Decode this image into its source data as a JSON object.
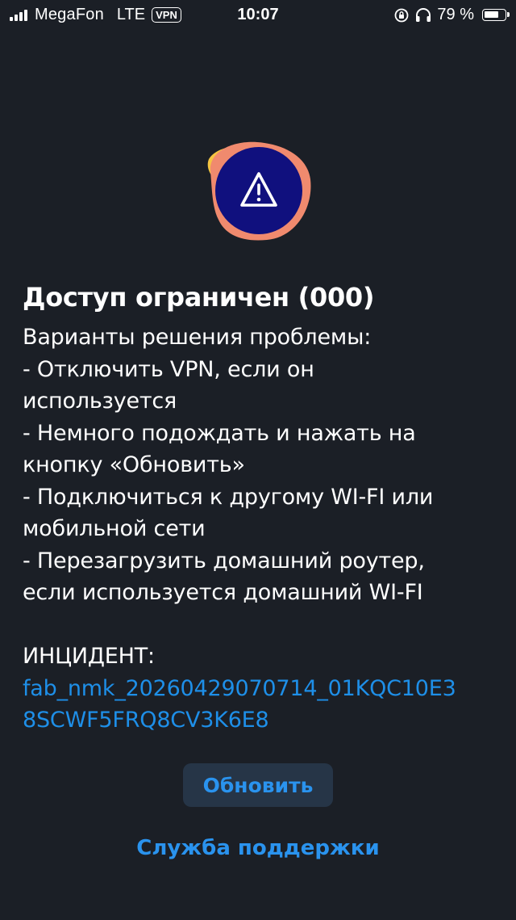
{
  "status_bar": {
    "carrier": "MegaFon",
    "network": "LTE",
    "vpn_badge": "VPN",
    "time": "10:07",
    "battery_percent_label": "79 %",
    "battery_level": 0.79,
    "icons": [
      "signal-icon",
      "orientation-lock-icon",
      "headphones-icon",
      "battery-icon"
    ]
  },
  "error": {
    "illustration_icon": "warning-icon",
    "title": "Доступ ограничен (000)",
    "body_lines": [
      "Варианты решения проблемы:",
      "- Отключить VPN, если он",
      "используется",
      "- Немного подождать и нажать на",
      "кнопку «Обновить»",
      "- Подключиться к другому WI-FI или",
      "мобильной сети",
      "- Перезагрузить домашний роутер,",
      "если используется домашний WI-FI"
    ],
    "incident_label": "ИНЦИДЕНТ:",
    "incident_id_lines": [
      "fab_nmk_20260429070714_01KQC10E3",
      "8SCWF5FRQ8CV3K6E8"
    ]
  },
  "actions": {
    "refresh_label": "Обновить",
    "support_label": "Служба поддержки"
  },
  "colors": {
    "background": "#1b1f26",
    "accent": "#2a93ee",
    "badge_navy": "#10107e",
    "blob_coral": "#f08a6e",
    "blob_yellow": "#f5c542"
  }
}
